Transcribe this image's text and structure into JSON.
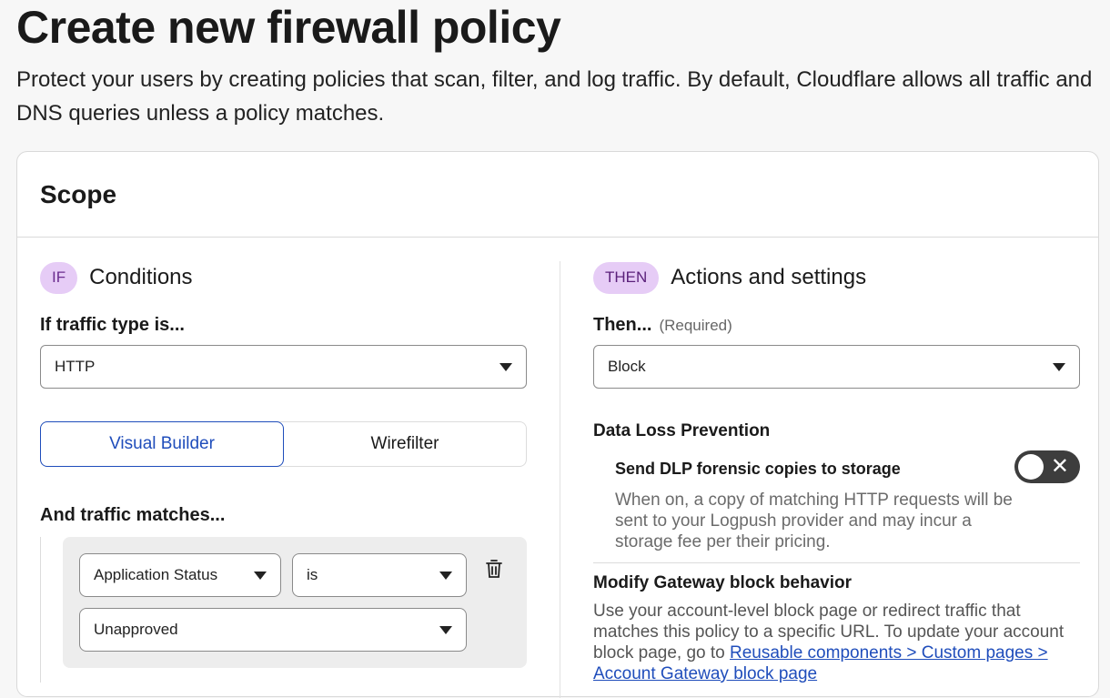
{
  "page": {
    "title": "Create new firewall policy",
    "description": "Protect your users by creating policies that scan, filter, and log traffic. By default, Cloudflare allows all traffic and DNS queries unless a policy matches."
  },
  "scope": {
    "title": "Scope",
    "conditions": {
      "pill": "IF",
      "title": "Conditions",
      "traffic_type_label": "If traffic type is...",
      "traffic_type_value": "HTTP",
      "builder_tabs": [
        {
          "label": "Visual Builder",
          "active": true
        },
        {
          "label": "Wirefilter",
          "active": false
        }
      ],
      "matches_label": "And traffic matches...",
      "rule": {
        "selector": "Application Status",
        "operator": "is",
        "value": "Unapproved"
      }
    },
    "actions": {
      "pill": "THEN",
      "title": "Actions and settings",
      "then_label": "Then...",
      "then_required": "(Required)",
      "action_value": "Block",
      "dlp": {
        "title": "Data Loss Prevention",
        "forensic_title": "Send DLP forensic copies to storage",
        "forensic_desc": "When on, a copy of matching HTTP requests will be sent to your Logpush provider and may incur a storage fee per their pricing.",
        "toggle_on": false
      },
      "gateway": {
        "title": "Modify Gateway block behavior",
        "desc_prefix": "Use your account-level block page or redirect traffic that matches this policy to a specific URL. To update your account block page, go to",
        "link_text": "Reusable components > Custom pages > Account Gateway block page"
      }
    }
  },
  "colors": {
    "accent_blue": "#1f4dbb",
    "pill_bg": "#e6ccf6",
    "toggle_off": "#3d3d3d"
  }
}
